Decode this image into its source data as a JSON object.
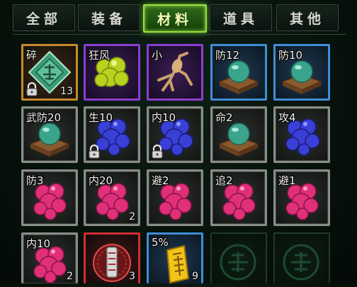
{
  "tabs": [
    {
      "label": "全部",
      "active": false
    },
    {
      "label": "装备",
      "active": false
    },
    {
      "label": "材料",
      "active": true
    },
    {
      "label": "道具",
      "active": false
    },
    {
      "label": "其他",
      "active": false
    }
  ],
  "slots": [
    {
      "label": "碎",
      "count": "13",
      "border": "orange",
      "icon": "jade-shard-icon",
      "locked": true
    },
    {
      "label": "狂风",
      "count": "",
      "border": "purple",
      "icon": "yellow-ore-icon",
      "locked": false
    },
    {
      "label": "小",
      "count": "",
      "border": "purple",
      "icon": "ginseng-root-icon",
      "locked": false
    },
    {
      "label": "防12",
      "count": "",
      "border": "blue",
      "icon": "jade-orb-box-icon",
      "locked": false
    },
    {
      "label": "防10",
      "count": "",
      "border": "blue",
      "icon": "jade-orb-box-icon",
      "locked": false
    },
    {
      "label": "武防20",
      "count": "",
      "border": "gray",
      "icon": "jade-orb-box-icon",
      "locked": false
    },
    {
      "label": "生10",
      "count": "",
      "border": "gray",
      "icon": "blue-ore-icon",
      "locked": true
    },
    {
      "label": "内10",
      "count": "",
      "border": "gray",
      "icon": "blue-ore-icon",
      "locked": true
    },
    {
      "label": "命2",
      "count": "",
      "border": "gray",
      "icon": "jade-orb-box-icon",
      "locked": false
    },
    {
      "label": "攻4",
      "count": "",
      "border": "gray",
      "icon": "blue-ore-icon",
      "locked": false
    },
    {
      "label": "防3",
      "count": "",
      "border": "gray",
      "icon": "pink-ore-icon",
      "locked": false
    },
    {
      "label": "内20",
      "count": "2",
      "border": "gray",
      "icon": "pink-ore-icon",
      "locked": false
    },
    {
      "label": "避2",
      "count": "",
      "border": "gray",
      "icon": "pink-ore-icon",
      "locked": false
    },
    {
      "label": "追2",
      "count": "",
      "border": "gray",
      "icon": "pink-ore-icon",
      "locked": false
    },
    {
      "label": "避1",
      "count": "",
      "border": "gray",
      "icon": "pink-ore-icon",
      "locked": false
    },
    {
      "label": "内10",
      "count": "2",
      "border": "gray",
      "icon": "pink-ore-icon",
      "locked": false
    },
    {
      "label": "",
      "count": "3",
      "border": "red",
      "icon": "red-seal-charm-icon",
      "locked": false
    },
    {
      "label": "5%",
      "count": "9",
      "border": "blue",
      "icon": "gold-talisman-icon",
      "locked": false
    },
    {
      "label": "",
      "count": "",
      "border": "empty",
      "icon": "empty-slot-emblem-icon",
      "locked": false
    },
    {
      "label": "",
      "count": "",
      "border": "empty",
      "icon": "empty-slot-emblem-icon",
      "locked": false
    }
  ],
  "colors": {
    "active_tab": "#9bdc3a",
    "orange": "#c98a2c",
    "purple": "#8a3fd0",
    "blue": "#3f8ed6",
    "red": "#cf2f35",
    "gray": "#8a8c88"
  }
}
